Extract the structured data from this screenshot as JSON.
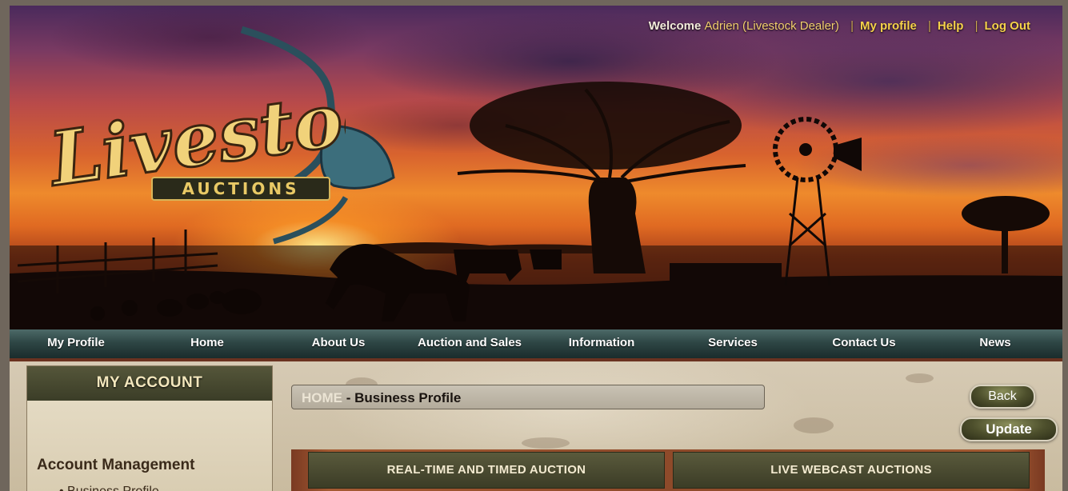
{
  "header": {
    "welcome": "Welcome",
    "user": "Adrien (Livestock Dealer)",
    "links": [
      "My profile",
      "Help",
      "Log Out"
    ],
    "logo_text": "Livestock",
    "logo_subtext": "AUCTIONS"
  },
  "nav": {
    "items": [
      "My Profile",
      "Home",
      "About Us",
      "Auction and Sales",
      "Information",
      "Services",
      "Contact Us",
      "News"
    ]
  },
  "sidebar": {
    "title": "MY ACCOUNT",
    "section": "Account Management",
    "items": [
      "Business Profile"
    ]
  },
  "breadcrumb": {
    "home": "HOME",
    "title": "- Business Profile"
  },
  "buttons": {
    "back": "Back",
    "update": "Update"
  },
  "auction_tabs": [
    "REAL-TIME AND TIMED AUCTION",
    "LIVE WEBCAST AUCTIONS"
  ],
  "colors": {
    "nav_bg": "#2e4645",
    "accent_gold": "#f6d24a",
    "panel_header": "#3b3c26",
    "content_bg": "#d6cab4"
  }
}
